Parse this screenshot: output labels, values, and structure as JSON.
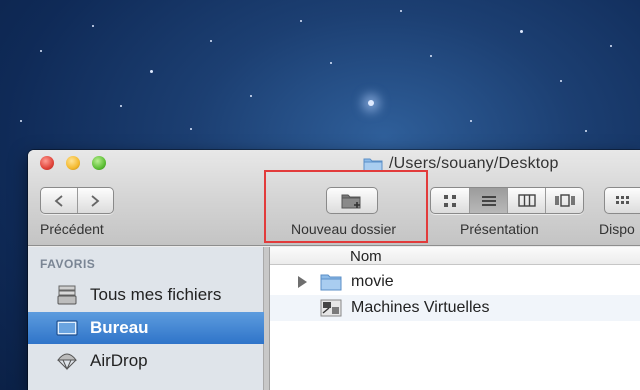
{
  "window": {
    "title": "/Users/souany/Desktop"
  },
  "toolbar": {
    "back_label": "Précédent",
    "new_folder_label": "Nouveau dossier",
    "presentation_label": "Présentation",
    "arrange_label": "Dispo",
    "active_view": "list"
  },
  "sidebar": {
    "section_title": "FAVORIS",
    "items": [
      {
        "label": "Tous mes fichiers",
        "icon": "all-files-icon",
        "selected": false
      },
      {
        "label": "Bureau",
        "icon": "desktop-icon",
        "selected": true
      },
      {
        "label": "AirDrop",
        "icon": "airdrop-icon",
        "selected": false
      }
    ]
  },
  "file_list": {
    "column_name": "Nom",
    "items": [
      {
        "label": "movie",
        "icon": "folder-icon",
        "expandable": true
      },
      {
        "label": "Machines Virtuelles",
        "icon": "virtual-machines-icon",
        "expandable": false
      }
    ]
  },
  "colors": {
    "selection": "#3a7fd0",
    "highlight_box": "#e23b3b",
    "folder": "#7fb3e8"
  }
}
